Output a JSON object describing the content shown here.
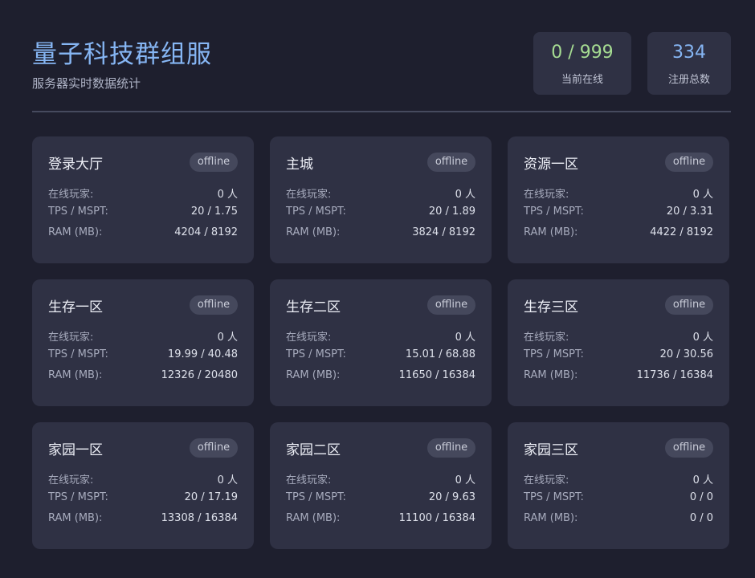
{
  "header": {
    "title": "量子科技群组服",
    "subtitle": "服务器实时数据统计"
  },
  "stats": {
    "online": {
      "value": "0 / 999",
      "label": "当前在线"
    },
    "registered": {
      "value": "334",
      "label": "注册总数"
    }
  },
  "labels": {
    "players": "在线玩家:",
    "tps": "TPS / MSPT:",
    "ram": "RAM (MB):"
  },
  "colors": {
    "background": "#1e1f2e",
    "card": "#2f3144",
    "title": "#86b6f4",
    "online_value": "#a6dc92",
    "registered_value": "#86b6f4",
    "badge": "#45485c"
  },
  "servers": [
    {
      "name": "登录大厅",
      "status": "offline",
      "players": "0 人",
      "tps": "20 / 1.75",
      "ram": "4204 / 8192"
    },
    {
      "name": "主城",
      "status": "offline",
      "players": "0 人",
      "tps": "20 / 1.89",
      "ram": "3824 / 8192"
    },
    {
      "name": "资源一区",
      "status": "offline",
      "players": "0 人",
      "tps": "20 / 3.31",
      "ram": "4422 / 8192"
    },
    {
      "name": "生存一区",
      "status": "offline",
      "players": "0 人",
      "tps": "19.99 / 40.48",
      "ram": "12326 / 20480"
    },
    {
      "name": "生存二区",
      "status": "offline",
      "players": "0 人",
      "tps": "15.01 / 68.88",
      "ram": "11650 / 16384"
    },
    {
      "name": "生存三区",
      "status": "offline",
      "players": "0 人",
      "tps": "20 / 30.56",
      "ram": "11736 / 16384"
    },
    {
      "name": "家园一区",
      "status": "offline",
      "players": "0 人",
      "tps": "20 / 17.19",
      "ram": "13308 / 16384"
    },
    {
      "name": "家园二区",
      "status": "offline",
      "players": "0 人",
      "tps": "20 / 9.63",
      "ram": "11100 / 16384"
    },
    {
      "name": "家园三区",
      "status": "offline",
      "players": "0 人",
      "tps": "0 / 0",
      "ram": "0 / 0"
    }
  ]
}
